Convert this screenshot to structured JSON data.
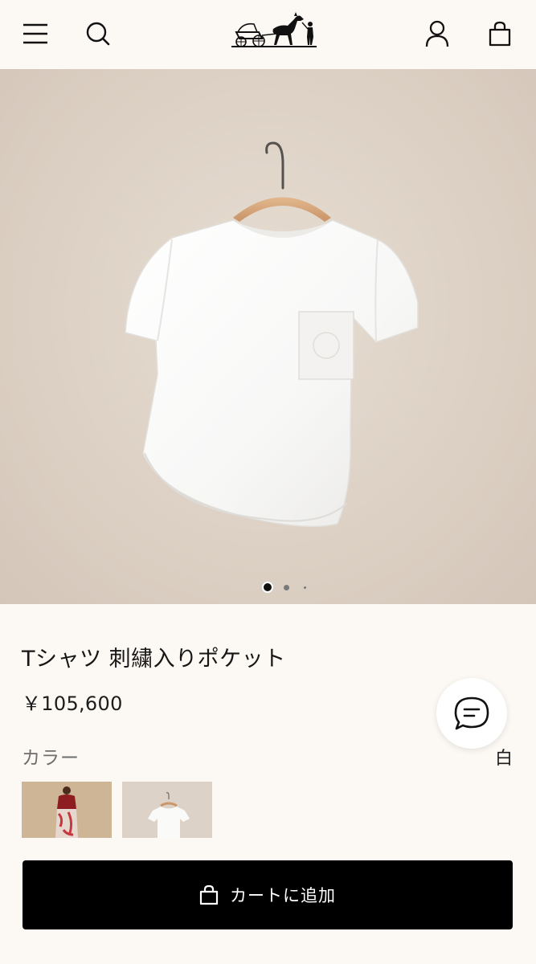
{
  "header": {
    "icons": {
      "menu": "hamburger-icon",
      "search": "search-icon",
      "logo": "horse-carriage-logo",
      "account": "user-icon",
      "cart": "shopping-bag-icon"
    }
  },
  "gallery": {
    "active_index": 1,
    "total": 3
  },
  "product": {
    "title": "Tシャツ 刺繍入りポケット",
    "price": "￥105,600",
    "color_label": "カラー",
    "color_value": "白",
    "swatches": [
      "red",
      "white"
    ]
  },
  "actions": {
    "add_to_cart": "カートに追加",
    "chat": "chat-icon"
  },
  "colors": {
    "background": "#fcf8f3",
    "button": "#000000",
    "button_text": "#ffffff"
  }
}
